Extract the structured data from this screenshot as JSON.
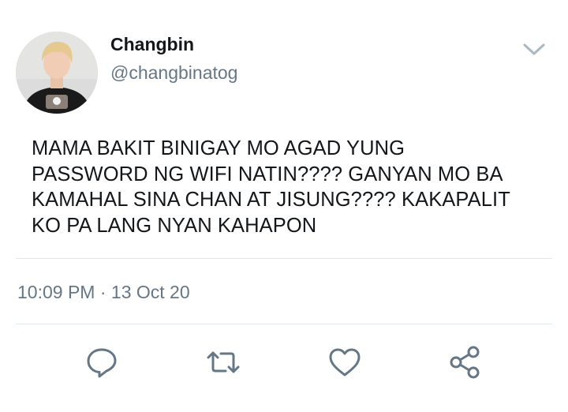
{
  "tweet": {
    "author_name": "Changbin",
    "author_handle": "@changbinatog",
    "text": "MAMA BAKIT BINIGAY MO AGAD YUNG\nPASSWORD NG WIFI NATIN???? GANYAN MO BA\nKAMAHAL SINA CHAN AT JISUNG???? KAKAPALIT\nKO PA LANG NYAN KAHAPON",
    "time": "10:09 PM",
    "separator": "·",
    "date": "13 Oct 20"
  },
  "icons": {
    "menu": "chevron-down-icon",
    "reply": "reply-icon",
    "retweet": "retweet-icon",
    "like": "heart-icon",
    "share": "share-icon"
  },
  "colors": {
    "text_primary": "#14171a",
    "text_secondary": "#657786",
    "icon": "#657786",
    "divider": "#e1e8ed"
  }
}
